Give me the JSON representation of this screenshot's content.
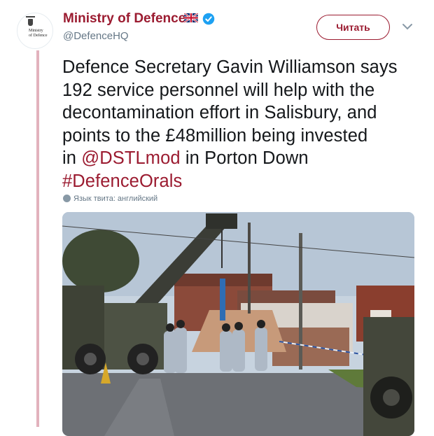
{
  "account": {
    "name": "Ministry of Defence",
    "handle": "@DefenceHQ",
    "avatar_text": [
      "Ministry",
      "of Defence"
    ],
    "verified": true,
    "flag_icon": "uk-flag-icon"
  },
  "actions": {
    "follow_label": "Читать",
    "menu_icon": "chevron-down-icon"
  },
  "tweet": {
    "line1": "Defence Secretary Gavin Williamson says",
    "line2": "192 service personnel will help with the",
    "line3": "decontamination effort in Salisbury, and",
    "line4": "points to the £48million being invested",
    "line5_prefix": "in ",
    "mention": "@DSTLmod",
    "line5_suffix": " in Porton Down",
    "hashtag": "#DefenceOrals",
    "language_note": "Язык твита: английский"
  },
  "colors": {
    "accent": "#9b1b30",
    "thread_line": "#e2b2bd",
    "secondary_text": "#657786",
    "verified_blue": "#1da1f2"
  }
}
